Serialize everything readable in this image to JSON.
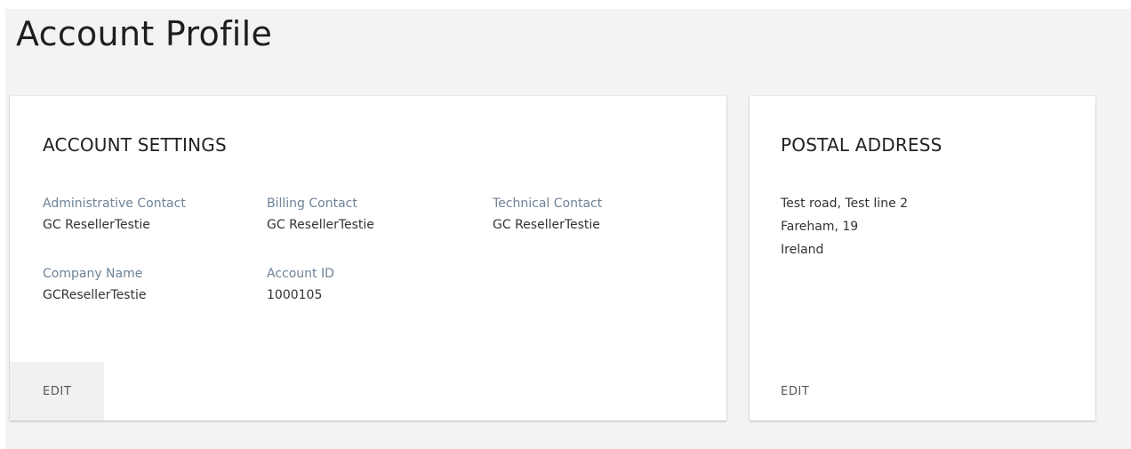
{
  "page": {
    "title": "Account Profile"
  },
  "account_settings": {
    "title": "ACCOUNT SETTINGS",
    "fields": [
      {
        "label": "Administrative Contact",
        "value": "GC ResellerTestie"
      },
      {
        "label": "Billing Contact",
        "value": "GC ResellerTestie"
      },
      {
        "label": "Technical Contact",
        "value": "GC ResellerTestie"
      },
      {
        "label": "Company Name",
        "value": "GCResellerTestie"
      },
      {
        "label": "Account ID",
        "value": "1000105"
      }
    ],
    "edit_label": "EDIT"
  },
  "postal_address": {
    "title": "POSTAL ADDRESS",
    "lines": [
      "Test road, Test line 2",
      "Fareham, 19",
      "Ireland"
    ],
    "edit_label": "EDIT"
  }
}
